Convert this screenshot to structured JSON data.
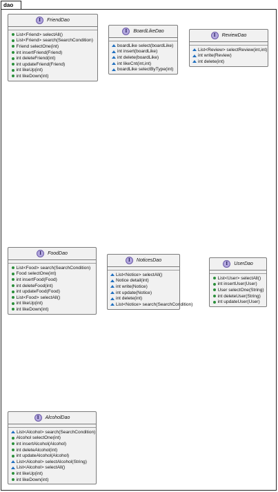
{
  "package": {
    "name": "dao"
  },
  "interfaces": [
    {
      "id": "frienddao",
      "name": "FriendDao",
      "stereotype_letter": "I",
      "members": [
        {
          "visibility": "public",
          "text": "List<Friend> selectAll()"
        },
        {
          "visibility": "public",
          "text": "List<Friend> search(SearchCondition)"
        },
        {
          "visibility": "public",
          "text": "Friend selectOne(int)"
        },
        {
          "visibility": "public",
          "text": "int insertFriend(Friend)"
        },
        {
          "visibility": "public",
          "text": "int deleteFriend(int)"
        },
        {
          "visibility": "public",
          "text": "int updateFriend(Friend)"
        },
        {
          "visibility": "public",
          "text": "int likeUp(int)"
        },
        {
          "visibility": "public",
          "text": "int likeDown(int)"
        }
      ]
    },
    {
      "id": "boardlikedao",
      "name": "BoardLikeDao",
      "stereotype_letter": "I",
      "members": [
        {
          "visibility": "package",
          "text": "boardLike select(boardLike)"
        },
        {
          "visibility": "package",
          "text": "int insert(boardLike)"
        },
        {
          "visibility": "package",
          "text": "int delete(boardLike)"
        },
        {
          "visibility": "package",
          "text": "int likeCnt(int,int)"
        },
        {
          "visibility": "package",
          "text": "boardLike selectByType(int)"
        }
      ]
    },
    {
      "id": "reviewdao",
      "name": "ReviewDao",
      "stereotype_letter": "I",
      "members": [
        {
          "visibility": "package",
          "text": "List<Review> selectReview(int,int)"
        },
        {
          "visibility": "package",
          "text": "int write(Review)"
        },
        {
          "visibility": "package",
          "text": "int delete(int)"
        }
      ]
    },
    {
      "id": "fooddao",
      "name": "FoodDao",
      "stereotype_letter": "I",
      "members": [
        {
          "visibility": "public",
          "text": "List<Food> search(SearchCondition)"
        },
        {
          "visibility": "public",
          "text": "Food selectOne(int)"
        },
        {
          "visibility": "public",
          "text": "int insertFood(Food)"
        },
        {
          "visibility": "public",
          "text": "int deleteFood(int)"
        },
        {
          "visibility": "public",
          "text": "int updateFood(Food)"
        },
        {
          "visibility": "public",
          "text": "List<Food> selectAll()"
        },
        {
          "visibility": "public",
          "text": "int likeUp(int)"
        },
        {
          "visibility": "public",
          "text": "int likeDown(int)"
        }
      ]
    },
    {
      "id": "noticesdao",
      "name": "NoticesDao",
      "stereotype_letter": "I",
      "members": [
        {
          "visibility": "package",
          "text": "List<Notice> selectAll()"
        },
        {
          "visibility": "package",
          "text": "Notice detail(int)"
        },
        {
          "visibility": "package",
          "text": "int write(Notice)"
        },
        {
          "visibility": "package",
          "text": "int update(Notice)"
        },
        {
          "visibility": "package",
          "text": "int delete(int)"
        },
        {
          "visibility": "package",
          "text": "List<Notice> search(SearchCondition)"
        }
      ]
    },
    {
      "id": "userdao",
      "name": "UserDao",
      "stereotype_letter": "I",
      "members": [
        {
          "visibility": "public",
          "text": "List<User> selectAll()"
        },
        {
          "visibility": "public",
          "text": "int insertUser(User)"
        },
        {
          "visibility": "public",
          "text": "User selectOne(String)"
        },
        {
          "visibility": "public",
          "text": "int deleteUser(String)"
        },
        {
          "visibility": "public",
          "text": "int updateUser(User)"
        }
      ]
    },
    {
      "id": "alcoholdao",
      "name": "AlcoholDao",
      "stereotype_letter": "I",
      "members": [
        {
          "visibility": "package",
          "text": "List<Alcohol> search(SearchCondition)"
        },
        {
          "visibility": "public",
          "text": "Alcohol selectOne(int)"
        },
        {
          "visibility": "public",
          "text": "int insertAlcohol(Alcohol)"
        },
        {
          "visibility": "public",
          "text": "int deleteAlcohol(int)"
        },
        {
          "visibility": "public",
          "text": "int updateAlcohol(Alcohol)"
        },
        {
          "visibility": "package",
          "text": "List<Alcohol> selectAlcohol(String)"
        },
        {
          "visibility": "package",
          "text": "List<Alcohol> selectAll()"
        },
        {
          "visibility": "public",
          "text": "int likeUp(int)"
        },
        {
          "visibility": "public",
          "text": "int likeDown(int)"
        }
      ]
    }
  ],
  "colors": {
    "box_fill": "#f1f1f1",
    "interface_icon": "#b3a8de",
    "public_marker": "#2a8f3a",
    "package_marker": "#1f6fbf"
  }
}
